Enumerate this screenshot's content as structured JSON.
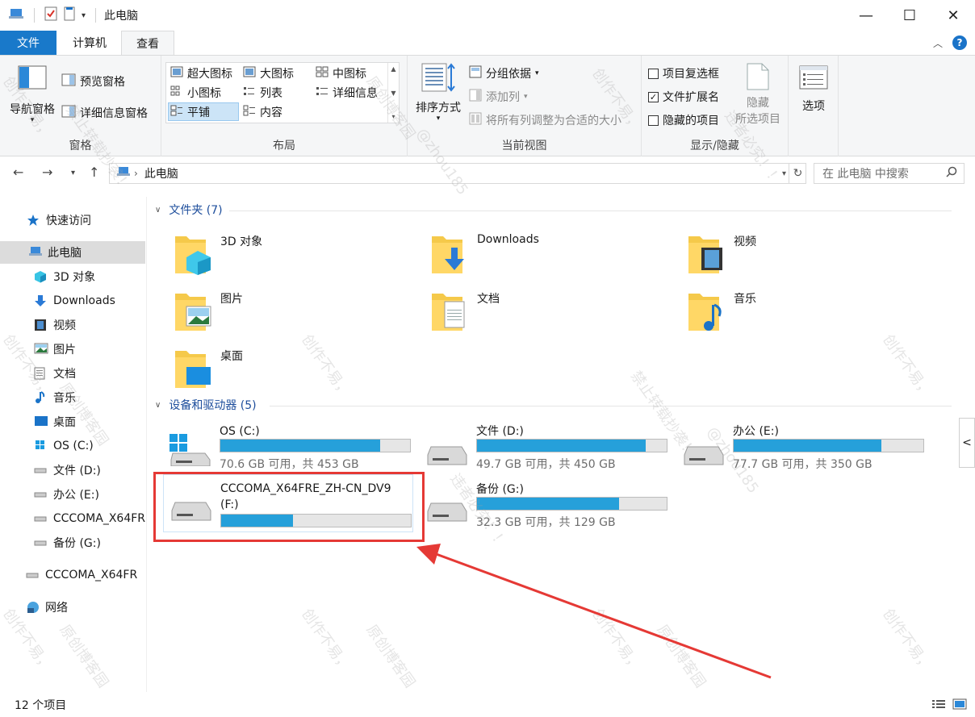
{
  "window": {
    "title": "此电脑",
    "controls": {
      "minimize": "—",
      "maximize": "☐",
      "close": "✕"
    }
  },
  "tabs": [
    {
      "label": "文件"
    },
    {
      "label": "计算机"
    },
    {
      "label": "查看"
    }
  ],
  "ribbon": {
    "panes": {
      "nav_pane": "导航窗格",
      "preview_pane": "预览窗格",
      "details_pane": "详细信息窗格",
      "group_label": "窗格"
    },
    "layout": {
      "extra_large": "超大图标",
      "large": "大图标",
      "medium": "中图标",
      "small": "小图标",
      "list": "列表",
      "details": "详细信息",
      "tiles": "平铺",
      "content": "内容",
      "group_label": "布局"
    },
    "current_view": {
      "sort_by": "排序方式",
      "group_by": "分组依据",
      "add_column": "添加列",
      "size_all": "将所有列调整为合适的大小",
      "group_label": "当前视图"
    },
    "show_hide": {
      "item_checkboxes": "项目复选框",
      "file_extensions": "文件扩展名",
      "hidden_items": "隐藏的项目",
      "hide_selected": "隐藏",
      "hide_selected_2": "所选项目",
      "group_label": "显示/隐藏"
    },
    "options": "选项"
  },
  "address": {
    "path": "此电脑",
    "search_placeholder": "在 此电脑 中搜索"
  },
  "sidebar": {
    "items": [
      {
        "label": "快速访问"
      },
      {
        "label": "此电脑"
      },
      {
        "label": "3D 对象"
      },
      {
        "label": "Downloads"
      },
      {
        "label": "视频"
      },
      {
        "label": "图片"
      },
      {
        "label": "文档"
      },
      {
        "label": "音乐"
      },
      {
        "label": "桌面"
      },
      {
        "label": "OS (C:)"
      },
      {
        "label": "文件 (D:)"
      },
      {
        "label": "办公 (E:)"
      },
      {
        "label": "CCCOMA_X64FR"
      },
      {
        "label": "备份 (G:)"
      },
      {
        "label": "CCCOMA_X64FR"
      },
      {
        "label": "网络"
      }
    ]
  },
  "folders": {
    "heading": "文件夹 (7)",
    "items": [
      {
        "label": "3D 对象"
      },
      {
        "label": "Downloads"
      },
      {
        "label": "视频"
      },
      {
        "label": "图片"
      },
      {
        "label": "文档"
      },
      {
        "label": "音乐"
      },
      {
        "label": "桌面"
      }
    ]
  },
  "drives": {
    "heading": "设备和驱动器 (5)",
    "items": [
      {
        "name": "OS (C:)",
        "free": "70.6 GB 可用，共 453 GB",
        "used_fraction": 0.844
      },
      {
        "name": "文件 (D:)",
        "free": "49.7 GB 可用，共 450 GB",
        "used_fraction": 0.89
      },
      {
        "name": "办公 (E:)",
        "free": "77.7 GB 可用，共 350 GB",
        "used_fraction": 0.778
      },
      {
        "name": "CCCOMA_X64FRE_ZH-CN_DV9",
        "name2": "(F:)",
        "free": "",
        "used_fraction": 0.38
      },
      {
        "name": "备份 (G:)",
        "free": "32.3 GB 可用，共 129 GB",
        "used_fraction": 0.75
      }
    ]
  },
  "status": {
    "count": "12 个项目"
  },
  "watermark": {
    "text1": "创作不易，",
    "text2": "原创博客园",
    "text3": "禁止转载抄袭！",
    "text4": "@zhou185",
    "text5": "违者必究！！"
  },
  "colors": {
    "accent": "#1979ca",
    "drive_bar": "#26a0da",
    "annotation": "#e53935"
  }
}
